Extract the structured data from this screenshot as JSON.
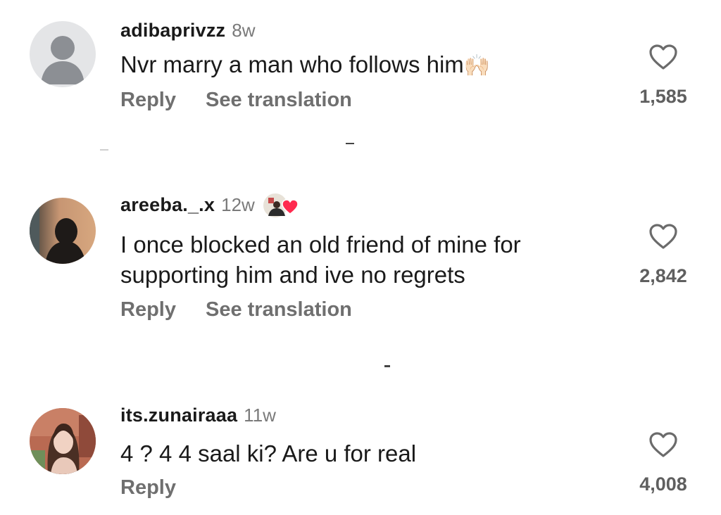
{
  "comments": [
    {
      "username": "adibaprivzz",
      "time": "8w",
      "text": "Nvr marry a man who follows him",
      "emoji": "🙌🏻",
      "reply": "Reply",
      "translate": "See translation",
      "likes": "1,585",
      "avatar": "default-avatar-icon"
    },
    {
      "username": "areeba._.x",
      "time": "12w",
      "text": "I once blocked an old friend of mine for supporting him and ive no regrets",
      "reply": "Reply",
      "translate": "See translation",
      "likes": "2,842",
      "avatar": "silhouette-photo",
      "creator_liked": true
    },
    {
      "username": "its.zunairaaa",
      "time": "11w",
      "text": "4 ? 4 4 saal ki? Are u for real",
      "reply": "Reply",
      "likes": "4,008",
      "avatar": "portrait-photo"
    }
  ],
  "colors": {
    "heart_outline": "#6b6b6b",
    "liked_heart": "#ff2a4f",
    "secondary_text": "#6f6f6f"
  }
}
